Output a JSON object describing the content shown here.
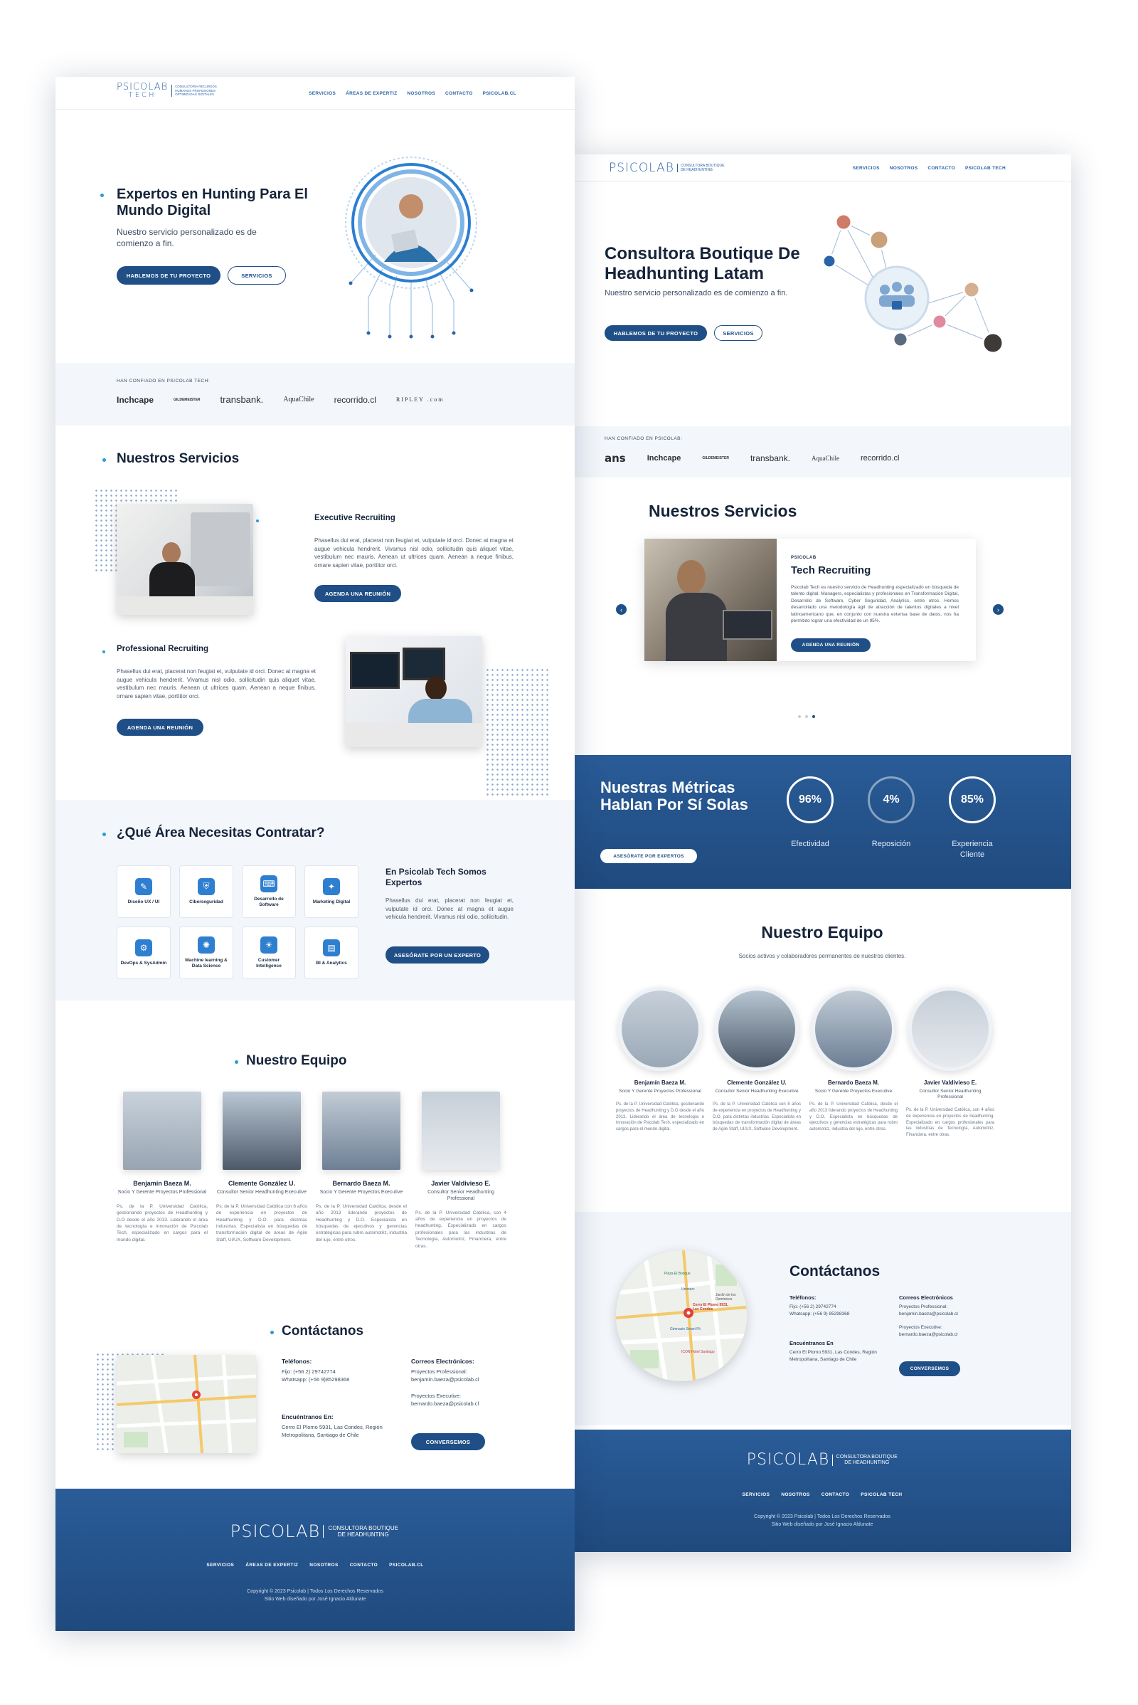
{
  "tech": {
    "logo": {
      "word": "PSICOLAB",
      "sub": "TECH",
      "tagline": "CONSULTORÍA RECURSOS HUMANOS PROFESIONES OPTIMIZADAS DIGITALES"
    },
    "nav": [
      "SERVICIOS",
      "ÁREAS DE EXPERTIZ",
      "NOSOTROS",
      "CONTACTO",
      "PSICOLAB.CL"
    ],
    "hero": {
      "title": "Expertos en Hunting Para El Mundo Digital",
      "subtitle": "Nuestro servicio personalizado es de comienzo a fin.",
      "cta_primary": "HABLEMOS DE TU PROYECTO",
      "cta_secondary": "SERVICIOS"
    },
    "trusted": {
      "label": "HAN CONFIADO EN PSICOLAB TECH:",
      "logos": [
        "Inchcape",
        "GILDEMEISTER",
        "transbank.",
        "AquaChile",
        "recorrido.cl",
        "RIPLEY .com"
      ]
    },
    "services": {
      "title": "Nuestros Servicios",
      "items": [
        {
          "title": "Executive Recruiting",
          "text": "Phasellus dui erat, placerat non feugiat et, vulputate id orci. Donec at magna et augue vehicula hendrerit. Vivamus nisl odio, sollicitudin quis aliquet vitae, vestibulum nec mauris. Aenean ut ultrices quam. Aenean a neque finibus, ornare sapien vitae, porttitor orci.",
          "cta": "AGENDA UNA REUNIÓN"
        },
        {
          "title": "Professional Recruiting",
          "text": "Phasellus dui erat, placerat non feugiat et, vulputate id orci. Donec at magna et augue vehicula hendrerit. Vivamus nisl odio, sollicitudin quis aliquet vitae, vestibulum nec mauris. Aenean ut ultrices quam. Aenean a neque finibus, ornare sapien vitae, porttitor orci.",
          "cta": "AGENDA UNA REUNIÓN"
        }
      ]
    },
    "areas": {
      "title": "¿Qué Área Necesitas Contratar?",
      "items": [
        "Diseño UX / UI",
        "Ciberseguridad",
        "Desarrollo de Software",
        "Marketing Digital",
        "DevOps & SysAdmin",
        "Machine learning & Data Science",
        "Customer Intelligence",
        "BI & Analytics"
      ],
      "aside_title": "En Psicolab Tech Somos Expertos",
      "aside_text": "Phasellus dui erat, placerat non feugiat et, vulputate id orci. Donec at magna et augue vehicula hendrerit. Vivamus nisl odio, sollicitudin.",
      "aside_cta": "ASESÓRATE POR UN EXPERTO"
    },
    "team": {
      "title": "Nuestro Equipo",
      "members": [
        {
          "name": "Benjamín Baeza M.",
          "role": "Socio Y Gerente Proyectos Professional",
          "bio": "Ps. de la P. Universidad Católica, gestionando proyectos de Headhunting y D.O desde el año 2013. Liderando el área de tecnología e innovación de Psicolab Tech, especializado en cargos para el mundo digital."
        },
        {
          "name": "Clemente González U.",
          "role": "Consultor Senior Headhunting Executive",
          "bio": "Ps. de la P. Universidad Católica con 8 años de experiencia en proyectos de Headhunting y D.O. para distintas industrias. Especialista en búsquedas de transformación digital de áreas de Agile Staff, UI/UX, Software Development."
        },
        {
          "name": "Bernardo Baeza M.",
          "role": "Socio Y Gerente Proyectos Executive",
          "bio": "Ps. de la P. Universidad Católica, desde el año 2013 liderando proyectos de Headhunting y D.O. Especialista en búsquedas de ejecutivos y gerencias estratégicas para rubro automotriz, industria del lujo, entre otros."
        },
        {
          "name": "Javier Valdivieso E.",
          "role": "Consultor Senior Headhunting Professional",
          "bio": "Ps. de la P. Universidad Católica, con 4 años de experiencia en proyectos de headhunting. Especializado en cargos profesionales para las industrias de Tecnología, Automotriz, Financiera, entre otras."
        }
      ]
    },
    "contact": {
      "title": "Contáctanos",
      "phones_h": "Teléfonos:",
      "phones": "Fijo: (+56 2) 29742774\nWhatsapp: (+56 9)85298368",
      "address_h": "Encuéntranos En:",
      "address": "Cerro El Plomo 5931, Las Condes, Región Metropolitana, Santiago de Chile",
      "emails_h": "Correos Electrónicos:",
      "emails": "Proyectos Professional:\nbenjamin.baeza@psicolab.cl\n\nProyectos Executive:\nbernardo.baeza@psicolab.cl",
      "cta": "CONVERSEMOS"
    },
    "footer": {
      "logo_word": "PSICOLAB",
      "logo_tag": "CONSULTORA BOUTIQUE DE HEADHUNTING",
      "links": [
        "SERVICIOS",
        "ÁREAS DE EXPERTIZ",
        "NOSOTROS",
        "CONTACTO",
        "PSICOLAB.CL"
      ],
      "copyright": "Copyright © 2023 Psicolab | Todos Los Derechos Reservados",
      "credit": "Sitio Web diseñado por José Ignacio Aldunate"
    }
  },
  "boutique": {
    "logo": {
      "word": "PSICOLAB",
      "tagline": "CONSULTORA BOUTIQUE DE HEADHUNTING"
    },
    "nav": [
      "SERVICIOS",
      "NOSOTROS",
      "CONTACTO",
      "PSICOLAB TECH"
    ],
    "hero": {
      "title": "Consultora Boutique De Headhunting Latam",
      "subtitle": "Nuestro servicio personalizado es de comienzo a fin.",
      "cta_primary": "HABLEMOS DE TU PROYECTO",
      "cta_secondary": "SERVICIOS"
    },
    "trusted": {
      "label": "HAN CONFIADO EN PSICOLAB:",
      "logos": [
        "ans",
        "Inchcape",
        "GILDEMEISTER",
        "transbank.",
        "AquaChile",
        "recorrido.cl"
      ]
    },
    "services": {
      "title": "Nuestros Servicios",
      "card_kicker": "PSICOLAB",
      "card_title": "Tech Recruiting",
      "card_text": "Psicolab Tech es nuestro servicio de Headhunting especializado en búsqueda de talento digital: Managers, especialistas y profesionales en Transformación Digital, Desarrollo de Software, Cyber Seguridad, Analytics, entre otros. Hemos desarrollado una metodología ágil de atracción de talentos digitales a nivel latinoamericano que, en conjunto con nuestra extensa base de datos, nos ha permitido lograr una efectividad de un 95%.",
      "card_cta": "AGENDA UNA REUNIÓN",
      "prev_icon": "chevron-left",
      "next_icon": "chevron-right"
    },
    "metrics": {
      "title": "Nuestras Métricas Hablan Por Sí Solas",
      "cta": "ASESÓRATE POR EXPERTOS",
      "items": [
        {
          "value": "96%",
          "label": "Efectividad"
        },
        {
          "value": "4%",
          "label": "Reposición"
        },
        {
          "value": "85%",
          "label": "Experiencia Cliente"
        }
      ]
    },
    "team": {
      "title": "Nuestro Equipo",
      "subtitle": "Socios activos y colaboradores permanentes de nuestros clientes.",
      "members": [
        {
          "name": "Benjamín Baeza M.",
          "role": "Socio Y Gerente Proyectos Professional",
          "bio": "Ps. de la P. Universidad Católica, gestionando proyectos de Headhunting y D.O desde el año 2013. Liderando el área de tecnología e innovación de Psicolab Tech, especializado en cargos para el mundo digital."
        },
        {
          "name": "Clemente González U.",
          "role": "Consultor Senior Headhunting Executive",
          "bio": "Ps. de la P. Universidad Católica con 8 años de experiencia en proyectos de Headhunting y D.O. para distintas industrias. Especialista en búsquedas de transformación digital de áreas de Agile Staff, UI/UX, Software Development."
        },
        {
          "name": "Bernardo Baeza M.",
          "role": "Socio Y Gerente Proyectos Executive",
          "bio": "Ps. de la P. Universidad Católica, desde el año 2013 liderando proyectos de Headhunting y D.O. Especialista en búsquedas de ejecutivos y gerencias estratégicas para rubro automotriz, industria del lujo, entre otros."
        },
        {
          "name": "Javier Valdivieso E.",
          "role": "Consultor Senior Headhunting Professional",
          "bio": "Ps. de la P. Universidad Católica, con 4 años de experiencia en proyectos de headhunting. Especializado en cargos profesionales para las industrias de Tecnología, Automotriz, Financiera, entre otras."
        }
      ]
    },
    "contact": {
      "title": "Contáctanos",
      "phones_h": "Teléfonos:",
      "phones": "Fijo: (+56 2) 29742774\nWhatsapp: (+56 9) 85298368",
      "address_h": "Encuéntranos En",
      "address": "Cerro El Plomo 5931, Las Condes, Región Metropolitana, Santiago de Chile",
      "emails_h": "Correos Electrónicos",
      "emails": "Proyectos Professional:\nbenjamin.baeza@psicolab.cl\n\nProyectos Executive:\nbernardo.baeza@psicolab.cl",
      "cta": "CONVERSEMOS",
      "map_labels": [
        "Cerro El Plomo 5931, Las Condes",
        "Unimarc",
        "ICON Hotel Santiago",
        "Gimnasio Smart Fit",
        "Plaza El Bosque",
        "Jardín de los Dominicos"
      ]
    },
    "footer": {
      "logo_word": "PSICOLAB",
      "logo_tag": "CONSULTORA BOUTIQUE DE HEADHUNTING",
      "links": [
        "SERVICIOS",
        "NOSOTROS",
        "CONTACTO",
        "PSICOLAB TECH"
      ],
      "copyright": "Copyright © 2023 Psicolab | Todos Los Derechos Reservados",
      "credit": "Sitio Web diseñado por José Ignacio Aldunate"
    }
  }
}
